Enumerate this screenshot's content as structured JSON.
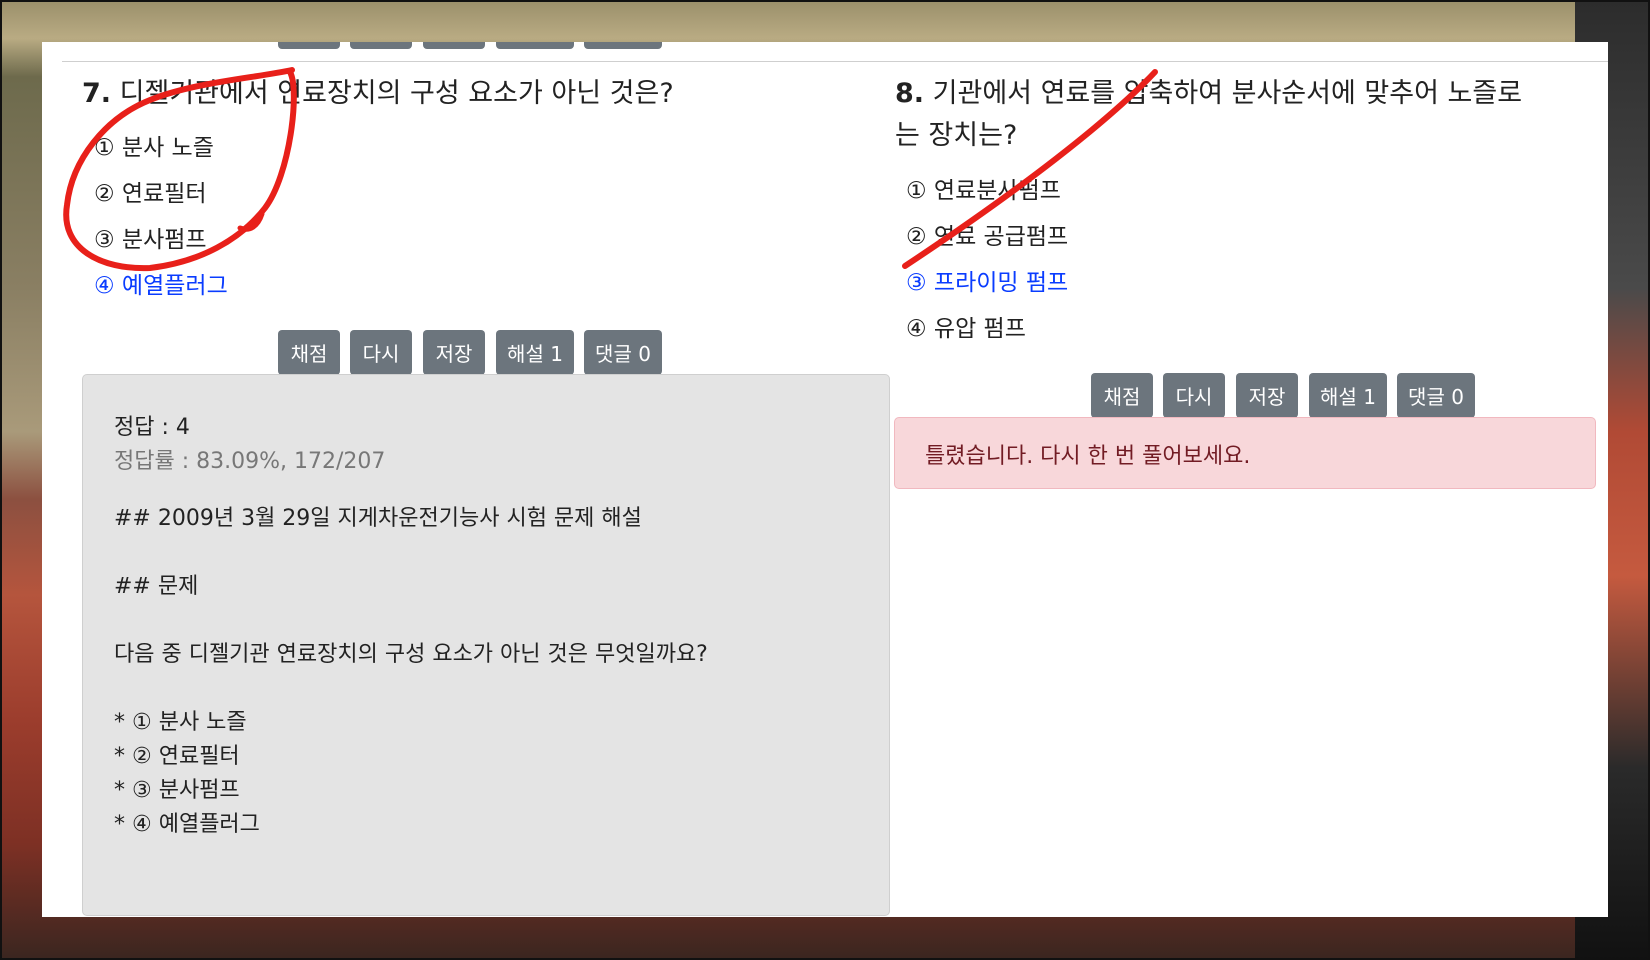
{
  "colors": {
    "button_bg": "#6c757d",
    "answer_color": "#0a3cff",
    "alert_bg": "#f8d7da",
    "alert_text": "#721c24",
    "marker_red": "#e8201a"
  },
  "q7": {
    "number": "7.",
    "title": "디젤기관에서 연료장치의 구성 요소가 아닌 것은?",
    "options": [
      "① 분사 노즐",
      "② 연료필터",
      "③ 분사펌프",
      "④ 예열플러그"
    ],
    "buttons": [
      "채점",
      "다시",
      "저장",
      "해설 1",
      "댓글 0"
    ],
    "explanation": {
      "answer": "정답 : 4",
      "rate": "정답률 : 83.09%, 172/207",
      "lines": [
        "## 2009년 3월 29일 지게차운전기능사 시험 문제 해설",
        "## 문제",
        "다음 중 디젤기관 연료장치의 구성 요소가 아닌 것은 무엇일까요?",
        "* ① 분사 노즐",
        "* ② 연료필터",
        "* ③ 분사펌프",
        "* ④ 예열플러그"
      ]
    }
  },
  "q8": {
    "number": "8.",
    "title_line1": "기관에서 연료를 압축하여 분사순서에 맞추어 노즐로",
    "title_line2": "는 장치는?",
    "options": [
      "① 연료분사펌프",
      "② 연료 공급펌프",
      "③ 프라이밍 펌프",
      "④ 유압 펌프"
    ],
    "buttons": [
      "채점",
      "다시",
      "저장",
      "해설 1",
      "댓글 0"
    ],
    "result": "틀렸습니다. 다시 한 번 풀어보세요."
  },
  "annotations": {
    "q7_mark": "circle-mark",
    "q8_mark": "slash-mark"
  }
}
